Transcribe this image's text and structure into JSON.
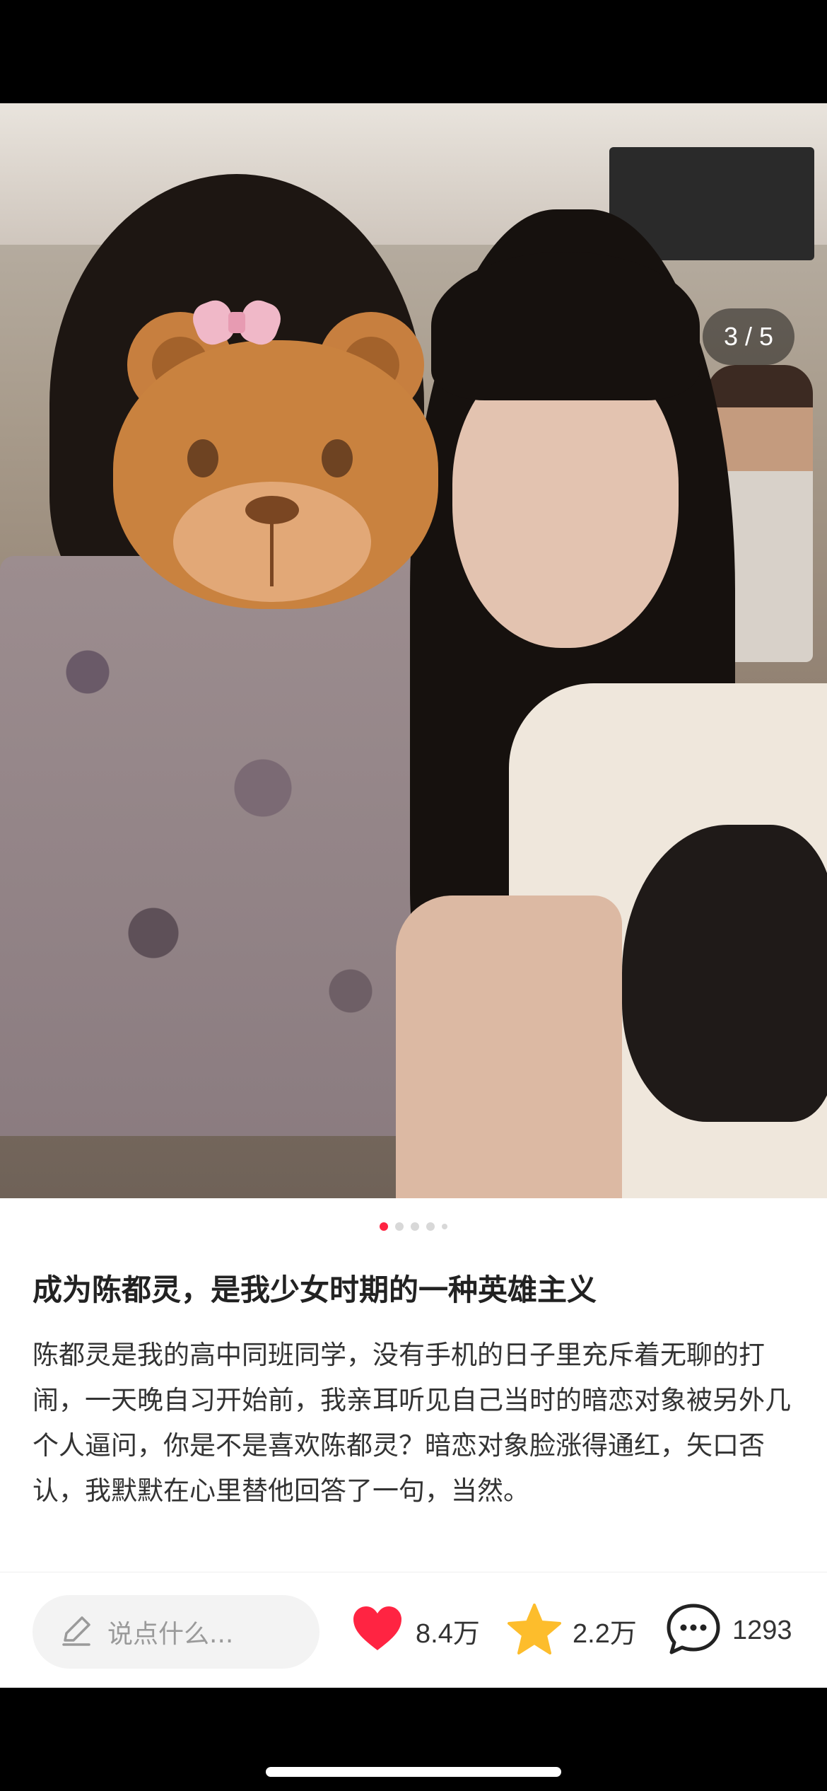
{
  "photo": {
    "counter": "3 / 5",
    "indicator": {
      "total": 5,
      "active_index": 0
    }
  },
  "post": {
    "title": "成为陈都灵，是我少女时期的一种英雄主义",
    "body": "陈都灵是我的高中同班同学，没有手机的日子里充斥着无聊的打闹，一天晚自习开始前，我亲耳听见自己当时的暗恋对象被另外几个人逼问，你是不是喜欢陈都灵？暗恋对象脸涨得通红，矢口否认，我默默在心里替他回答了一句，当然。"
  },
  "action_bar": {
    "comment_placeholder": "说点什么...",
    "comment_icon": "pencil-icon",
    "like": {
      "icon": "heart-icon",
      "count": "8.4万",
      "color": "#ff2442"
    },
    "collect": {
      "icon": "star-icon",
      "count": "2.2万",
      "color": "#fdbd2c"
    },
    "comment": {
      "icon": "chat-bubble-icon",
      "count": "1293"
    }
  },
  "colors": {
    "accent": "#ff2442",
    "text_primary": "#222222",
    "text_secondary": "#333333",
    "placeholder": "#9a9a9a"
  }
}
